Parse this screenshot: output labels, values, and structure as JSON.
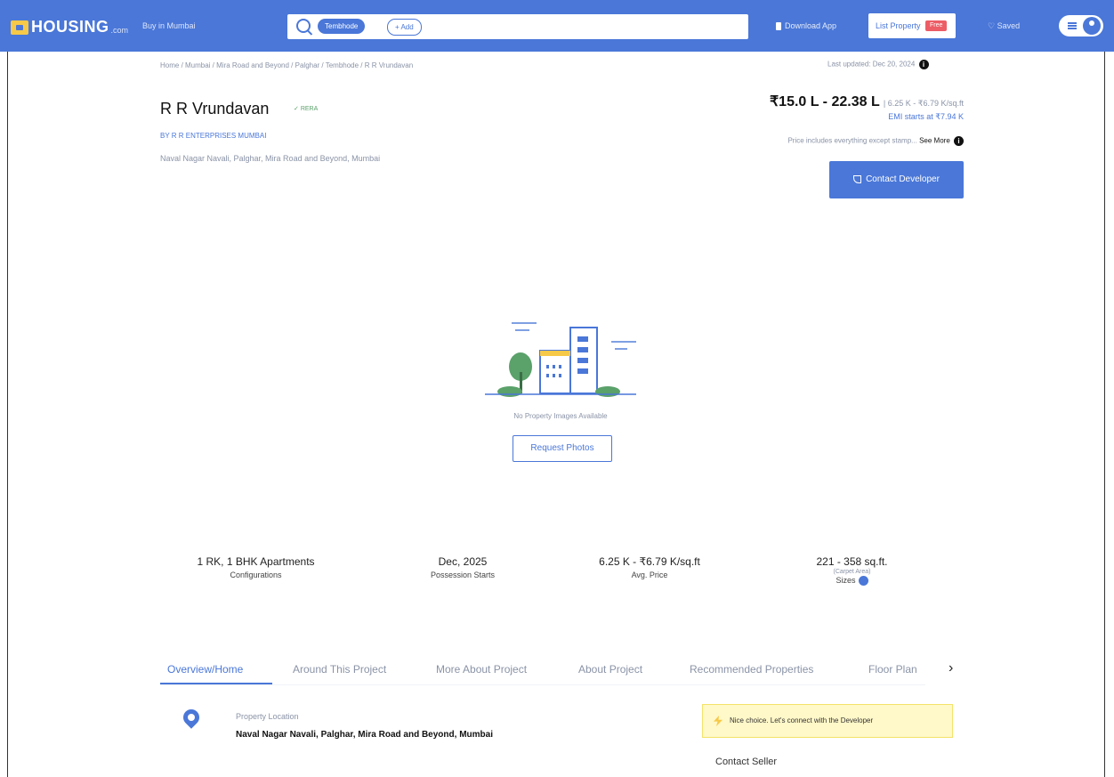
{
  "header": {
    "logo_text": "HOUSING",
    "logo_domain": ".com",
    "city_label": "Buy in Mumbai",
    "search_chip": "Tembhode",
    "add_chip": "+ Add",
    "download_app": "Download App",
    "list_property": "List Property",
    "free_badge": "Free",
    "saved": "Saved"
  },
  "breadcrumb": "Home / Mumbai / Mira Road and Beyond / Palghar / Tembhode / R R Vrundavan",
  "last_updated": "Last updated: Dec 20, 2024",
  "project": {
    "title": "R R Vrundavan",
    "rera": "RERA",
    "developer": "By R R ENTERPRISES MUMBAI",
    "address": "Naval Nagar Navali, Palghar, Mira Road and Beyond, Mumbai"
  },
  "pricing": {
    "range": "₹15.0 L - 22.38 L",
    "per_sqft": "6.25 K - ₹6.79 K/sq.ft",
    "emi": "EMI starts at ₹7.94 K",
    "note": "Price includes everything except stamp...",
    "see_more": "See More",
    "contact_button": "Contact Developer"
  },
  "gallery": {
    "no_images": "No Property Images Available",
    "request_button": "Request Photos"
  },
  "facts": [
    {
      "value": "1 RK, 1 BHK Apartments",
      "label": "Configurations"
    },
    {
      "value": "Dec, 2025",
      "label": "Possession Starts"
    },
    {
      "value": "6.25 K - ₹6.79 K/sq.ft",
      "label": "Avg. Price"
    },
    {
      "value": "221 - 358 sq.ft.",
      "sub": "(Carpet Area)",
      "label": "Sizes"
    }
  ],
  "tabs": [
    "Overview/Home",
    "Around This Project",
    "More About Project",
    "About Project",
    "Recommended Properties",
    "Floor Plan"
  ],
  "location": {
    "label": "Property Location",
    "value": "Naval Nagar Navali, Palghar, Mira Road and Beyond, Mumbai"
  },
  "nice_choice": "Nice choice. Let's connect with the Developer",
  "contact_seller": "Contact Seller",
  "colors": {
    "brand": "#4a77d8",
    "free_badge": "#ec5d66",
    "nice_box": "#fff8c8"
  }
}
